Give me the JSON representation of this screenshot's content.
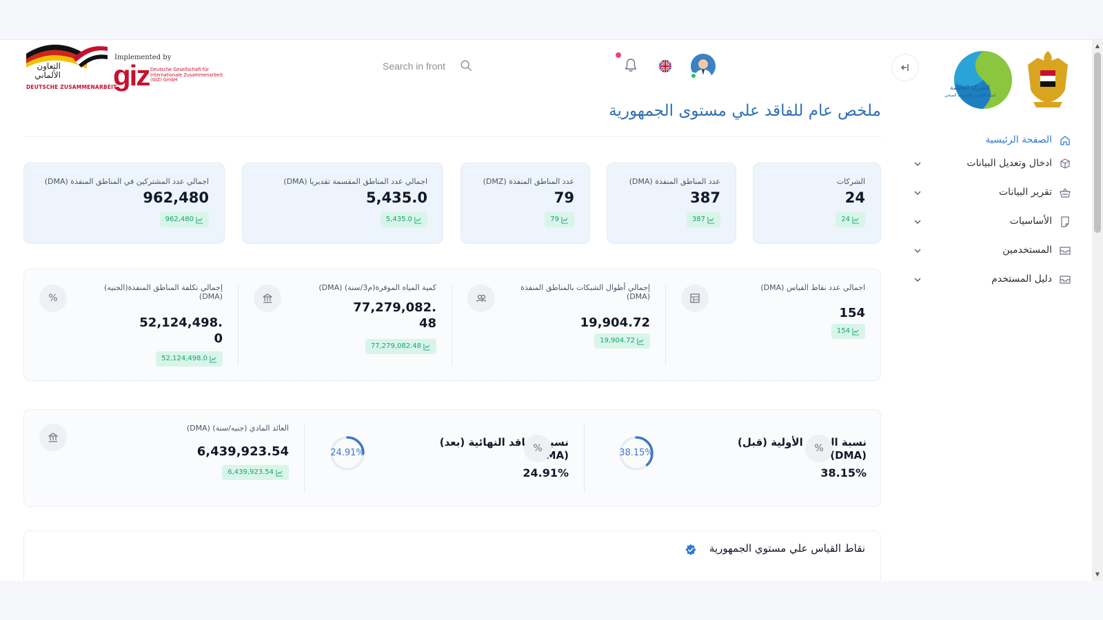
{
  "header": {
    "giz": {
      "arabic": "التعاون الألماني",
      "deutsche": "DEUTSCHE ZUSAMMENARBEIT",
      "implemented_by": "Implemented by",
      "word": "giz",
      "sub": "Deutsche Gesellschaft für Internationale Zusammenarbeit (GIZ) GmbH"
    },
    "search": {
      "placeholder": "Search in front"
    },
    "icons": {
      "search": "search-icon",
      "bell": "bell-icon",
      "language": "uk-flag-icon",
      "collapse": "collapse-sidebar-icon"
    }
  },
  "sidebar": {
    "menu": [
      {
        "label": "الصفحة الرئيسية",
        "icon": "home-icon",
        "active": true,
        "has_children": false
      },
      {
        "label": "ادخال وتعديل البيانات",
        "icon": "cube-icon",
        "active": false,
        "has_children": true
      },
      {
        "label": "تقرير البيانات",
        "icon": "basket-icon",
        "active": false,
        "has_children": true
      },
      {
        "label": "الأساسيات",
        "icon": "document-icon",
        "active": false,
        "has_children": true
      },
      {
        "label": "المستخدمين",
        "icon": "inbox-icon",
        "active": false,
        "has_children": true
      },
      {
        "label": "دليل المستخدم",
        "icon": "inbox-icon",
        "active": false,
        "has_children": true
      }
    ]
  },
  "main": {
    "page_title": "ملخص عام للفاقد علي مستوى الجمهورية",
    "kpis": [
      {
        "label": "الشركات",
        "value": "24",
        "badge": "24"
      },
      {
        "label": "عدد المناطق المنفذة (DMA)",
        "value": "387",
        "badge": "387"
      },
      {
        "label": "عدد المناطق المنفذة (DMZ)",
        "value": "79",
        "badge": "79"
      },
      {
        "label": "اجمالي عدد المناطق المقسمة تقديريا (DMA)",
        "value": "5,435.0",
        "badge": "5,435.0"
      },
      {
        "label": "اجمالي عدد المشتركين في المناطق المنفذة (DMA)",
        "value": "962,480",
        "badge": "962,480"
      }
    ],
    "stats": [
      {
        "label_line1": "اجمالي عدد نقاط القياس (DMA)",
        "label_line2": "",
        "value_line1": "154",
        "value_line2": "",
        "badge": "154",
        "icon": "table-icon"
      },
      {
        "label_line1": "إجمالي أطوال الشبكات بالمناطق المنفذة",
        "label_line2": "(DMA)",
        "value_line1": "19,904.72",
        "value_line2": "",
        "badge": "19,904.72",
        "icon": "users-icon"
      },
      {
        "label_line1": "كمية المياه الموفرة(م3/سنة) (DMA)",
        "label_line2": "",
        "value_line1": "77,279,082.",
        "value_line2": "48",
        "badge": "77,279,082.48",
        "icon": "bank-icon"
      },
      {
        "label_line1": "إجمالي تكلفة المناطق المنفذة(الجنيه)",
        "label_line2": "(DMA)",
        "value_line1": "52,124,498.",
        "value_line2": "0",
        "badge": "52,124,498.0",
        "icon": "percent-icon"
      }
    ],
    "percent_symbol": "%",
    "losses": {
      "initial": {
        "label_line1": "نسبة الفاقد الأولية (قبل)",
        "label_line2": "(DMA)",
        "value": "38.15%",
        "gauge_text": "38.15%",
        "fraction": 0.3815
      },
      "final": {
        "label_line1": "نسبة الفاقد النهائية (بعد)",
        "label_line2": "(DMA)",
        "value": "24.91%",
        "gauge_text": "24.91%",
        "fraction": 0.2491
      },
      "revenue": {
        "label": "العائد المادي (جنيه/سنة) (DMA)",
        "value": "6,439,923.54",
        "badge": "6,439,923.54",
        "icon": "bank-icon"
      }
    },
    "measurement_title": "نقاط القياس علي مستوي الجمهورية"
  },
  "colors": {
    "accent": "#2e7bd6",
    "title": "#2f6fb5",
    "badge_bg": "#d8f5ea",
    "badge_text": "#16a36b",
    "kpi_bg": "#eef4fb",
    "notification": "#ec4673"
  }
}
